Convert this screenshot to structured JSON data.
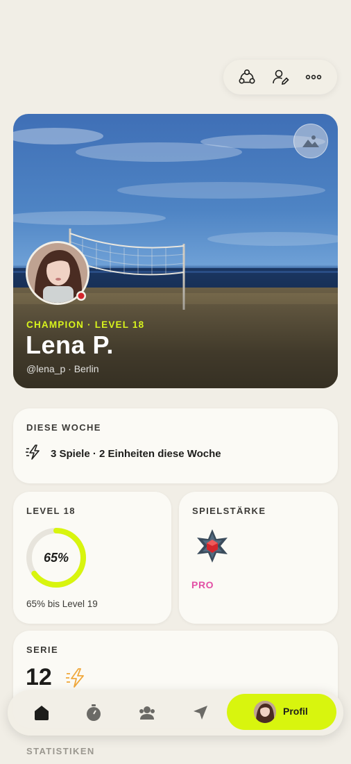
{
  "profile": {
    "rank_line": "CHAMPION · LEVEL 18",
    "name": "Lena P.",
    "handle": "@lena_p · Berlin"
  },
  "week": {
    "label": "DIESE WOCHE",
    "summary": "3 Spiele · 2 Einheiten diese Woche"
  },
  "level": {
    "label": "LEVEL 18",
    "progress_percent": 65,
    "progress_text": "65%",
    "sub": "65% bis Level 19"
  },
  "strength": {
    "label": "SPIELSTÄRKE",
    "tier": "PRO"
  },
  "series": {
    "label": "SERIE",
    "count": "12"
  },
  "stats": {
    "label": "STATISTIKEN"
  },
  "nav": {
    "profile_label": "Profil"
  },
  "icons": {
    "top_actions": [
      "friends-circle-icon",
      "edit-profile-icon",
      "more-icon"
    ],
    "tabs": [
      "home-icon",
      "stopwatch-icon",
      "community-icon",
      "send-icon"
    ],
    "photo": "change-cover-photo-icon",
    "week": "bolt-icon",
    "series": "bolt-icon"
  },
  "colors": {
    "accent_lime": "#d8f50e",
    "rank_yellow": "#d8f31d",
    "tier_pink": "#e24fa5",
    "streak_orange": "#f0a83c",
    "background": "#f1eee6"
  }
}
